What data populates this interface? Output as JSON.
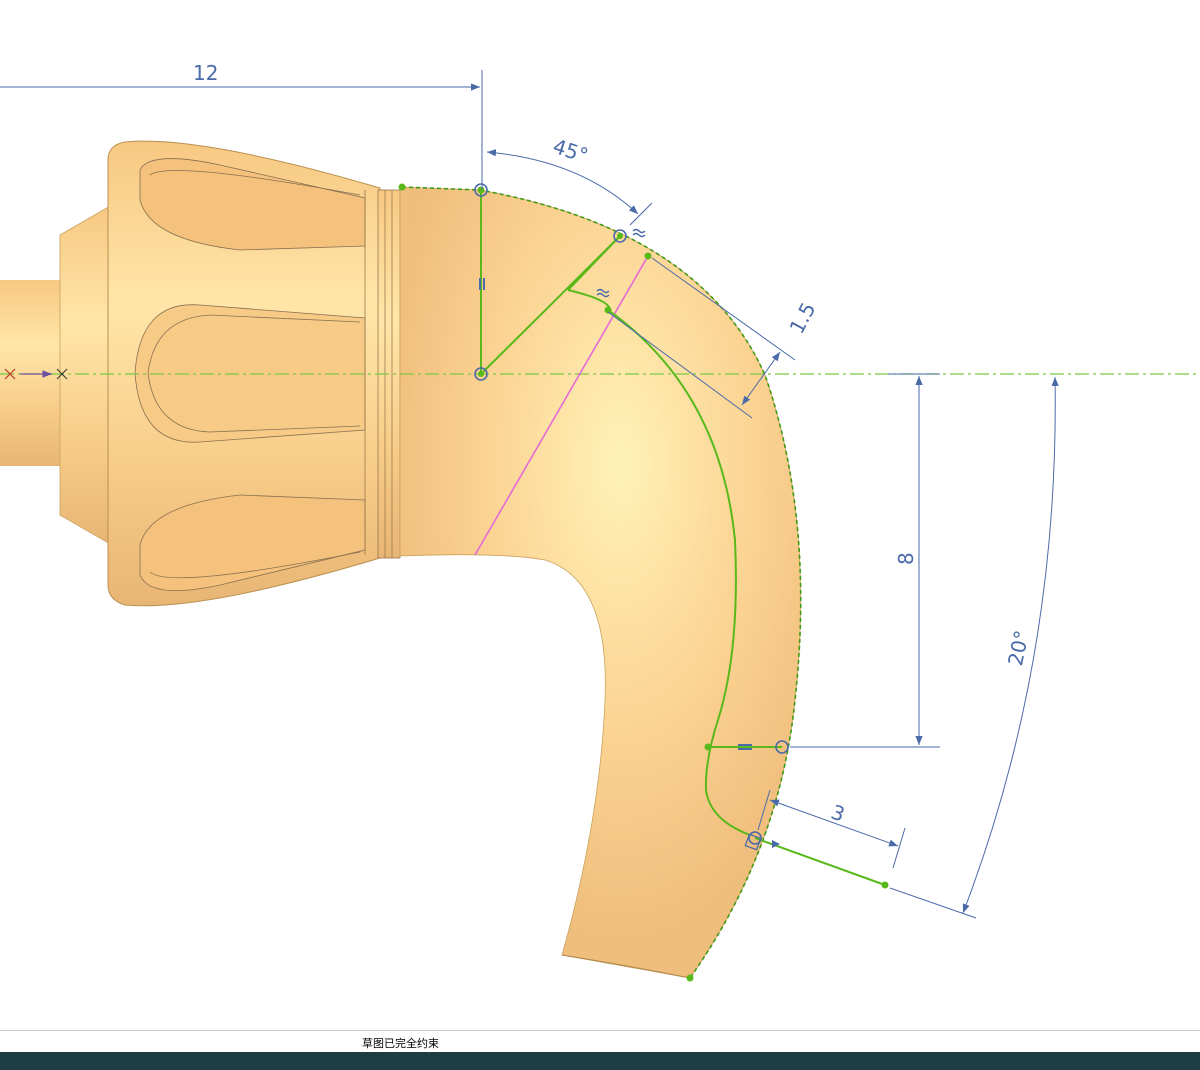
{
  "colors": {
    "part": "#fcd38f",
    "part_edge": "#c9a35e",
    "sketch_green": "#59b81a",
    "dimension_blue": "#4a6aa8",
    "axis_red": "#c0392b",
    "magenta": "#e66bd6",
    "taskbar": "#1f3d45"
  },
  "dimensions": {
    "horizontal_length": "12",
    "angle_top": "45°",
    "offset": "1.5",
    "vertical_length": "8",
    "angle_side": "20°",
    "end_length": "3"
  },
  "status": {
    "message": "草图已完全约束"
  },
  "icons": {
    "axis_origin": "x-mark-icon",
    "parallel_constraint": "parallel-icon",
    "equal_constraint": "equal-icon",
    "perpendicular_constraint": "perpendicular-icon"
  }
}
